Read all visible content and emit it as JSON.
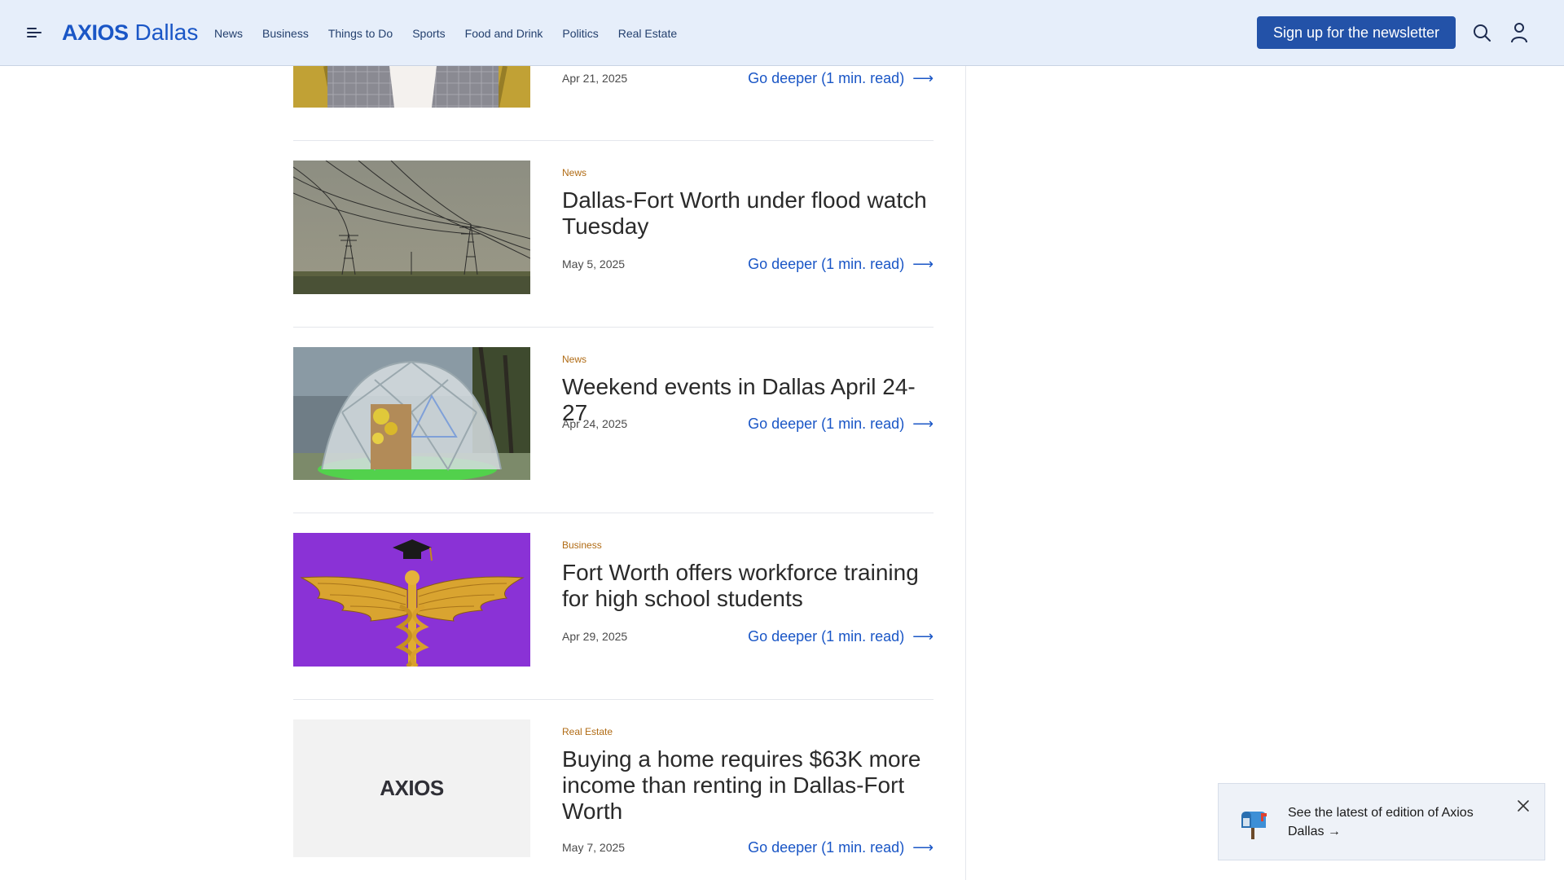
{
  "header": {
    "logo_mark": "AXIOS",
    "logo_city": "Dallas",
    "nav": [
      "News",
      "Business",
      "Things to Do",
      "Sports",
      "Food and Drink",
      "Politics",
      "Real Estate"
    ],
    "signup_label": "Sign up for the newsletter"
  },
  "articles": [
    {
      "category": "",
      "title": "",
      "date": "Apr 21, 2025",
      "cta": "Go deeper (1 min. read)"
    },
    {
      "category": "News",
      "title": "Dallas-Fort Worth under flood watch Tuesday",
      "date": "May 5, 2025",
      "cta": "Go deeper (1 min. read)"
    },
    {
      "category": "News",
      "title": "Weekend events in Dallas April 24-27",
      "date": "Apr 24, 2025",
      "cta": "Go deeper (1 min. read)"
    },
    {
      "category": "Business",
      "title": "Fort Worth offers workforce training for high school students",
      "date": "Apr 29, 2025",
      "cta": "Go deeper (1 min. read)"
    },
    {
      "category": "Real Estate",
      "title": "Buying a home requires $63K more income than renting in Dallas-Fort Worth",
      "date": "May 7, 2025",
      "cta": "Go deeper (1 min. read)",
      "thumb_logo": "AXIOS"
    }
  ],
  "toast": {
    "text": "See the latest of edition of Axios Dallas →"
  },
  "colors": {
    "header_bg": "#e6eefa",
    "accent": "#1a56c6",
    "button": "#2352a8",
    "category": "#b06b14"
  },
  "icons": [
    "menu-icon",
    "search-icon",
    "user-icon",
    "arrow-right-icon",
    "mailbox-icon",
    "close-icon"
  ]
}
